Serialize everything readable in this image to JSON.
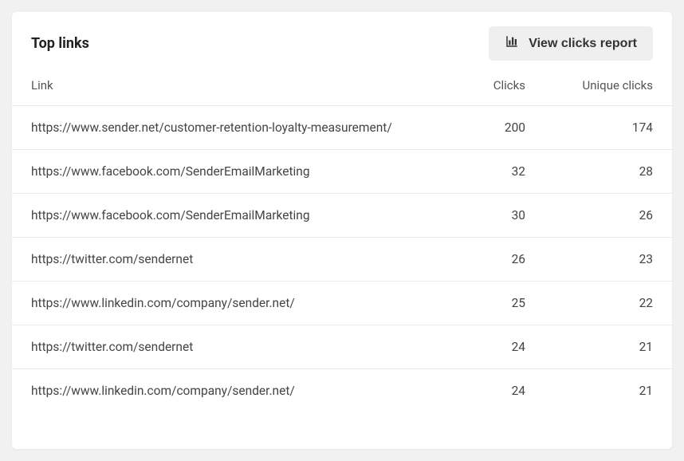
{
  "header": {
    "title": "Top links",
    "view_button_label": "View clicks report"
  },
  "table": {
    "columns": {
      "link": "Link",
      "clicks": "Clicks",
      "unique": "Unique clicks"
    },
    "rows": [
      {
        "link": "https://www.sender.net/customer-retention-loyalty-measurement/",
        "clicks": "200",
        "unique": "174"
      },
      {
        "link": "https://www.facebook.com/SenderEmailMarketing",
        "clicks": "32",
        "unique": "28"
      },
      {
        "link": "https://www.facebook.com/SenderEmailMarketing",
        "clicks": "30",
        "unique": "26"
      },
      {
        "link": "https://twitter.com/sendernet",
        "clicks": "26",
        "unique": "23"
      },
      {
        "link": "https://www.linkedin.com/company/sender.net/",
        "clicks": "25",
        "unique": "22"
      },
      {
        "link": "https://twitter.com/sendernet",
        "clicks": "24",
        "unique": "21"
      },
      {
        "link": "https://www.linkedin.com/company/sender.net/",
        "clicks": "24",
        "unique": "21"
      }
    ]
  }
}
